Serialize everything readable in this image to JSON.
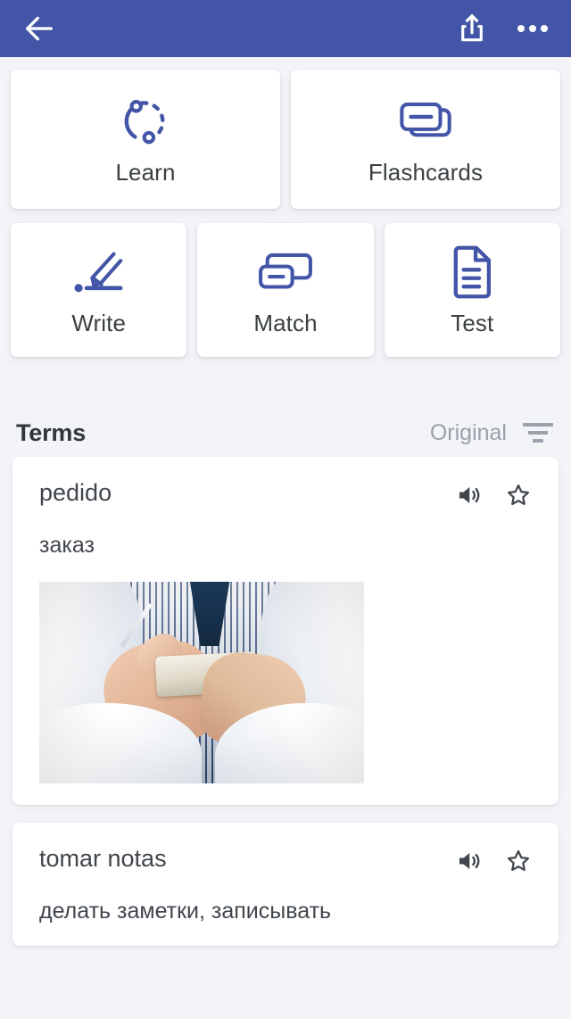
{
  "header": {
    "back_icon": "back-arrow-icon",
    "share_icon": "share-icon",
    "more_icon": "more-options-icon",
    "background_color": "#4355a6"
  },
  "study_modes": {
    "accent_color": "#3f9a9a",
    "icon_color": "#4355a6",
    "row1": [
      {
        "id": "learn",
        "label": "Learn",
        "icon": "learn-circle-icon"
      },
      {
        "id": "flashcards",
        "label": "Flashcards",
        "icon": "flashcards-stack-icon"
      }
    ],
    "row2": [
      {
        "id": "write",
        "label": "Write",
        "icon": "write-pencil-icon"
      },
      {
        "id": "match",
        "label": "Match",
        "icon": "match-cards-icon"
      },
      {
        "id": "test",
        "label": "Test",
        "icon": "test-document-icon"
      }
    ]
  },
  "terms_section": {
    "title": "Terms",
    "sort_label": "Original",
    "sort_icon": "sort-filter-icon",
    "items": [
      {
        "term": "pedido",
        "definition": "заказ",
        "audio_icon": "speaker-icon",
        "star_icon": "star-outline-icon",
        "has_image": true,
        "image_alt": "hands holding a small notepad and pen, striped shirt"
      },
      {
        "term": "tomar notas",
        "definition": "делать заметки, записывать",
        "audio_icon": "speaker-icon",
        "star_icon": "star-outline-icon",
        "has_image": false
      }
    ]
  }
}
